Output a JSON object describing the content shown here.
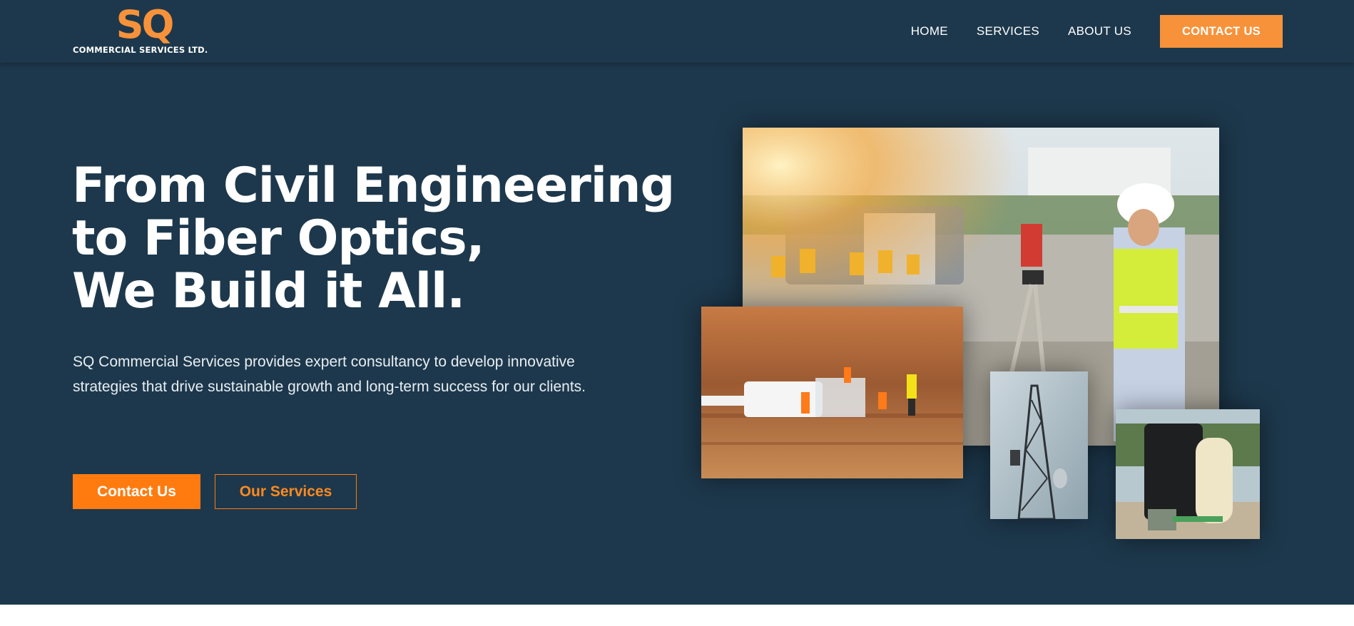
{
  "brand": {
    "logo_mark": "SQ",
    "logo_subtitle": "COMMERCIAL SERVICES LTD.",
    "accent_color": "#f7923a",
    "background_color": "#1d384c"
  },
  "nav": {
    "items": [
      {
        "label": "HOME"
      },
      {
        "label": "SERVICES"
      },
      {
        "label": "ABOUT US"
      }
    ],
    "cta_label": "CONTACT US"
  },
  "hero": {
    "headline_lines": [
      "From Civil Engineering",
      "to Fiber Optics,",
      "We Build it All."
    ],
    "description": "SQ Commercial Services provides expert consultancy to develop innovative strategies that drive sustainable growth and long-term success for our clients.",
    "primary_button": "Contact Us",
    "secondary_button": "Our Services"
  },
  "images": [
    {
      "name": "surveyor-construction-site"
    },
    {
      "name": "miniature-workers-fiber-cable"
    },
    {
      "name": "telecom-tower-climber"
    },
    {
      "name": "water-storage-tanks"
    }
  ]
}
